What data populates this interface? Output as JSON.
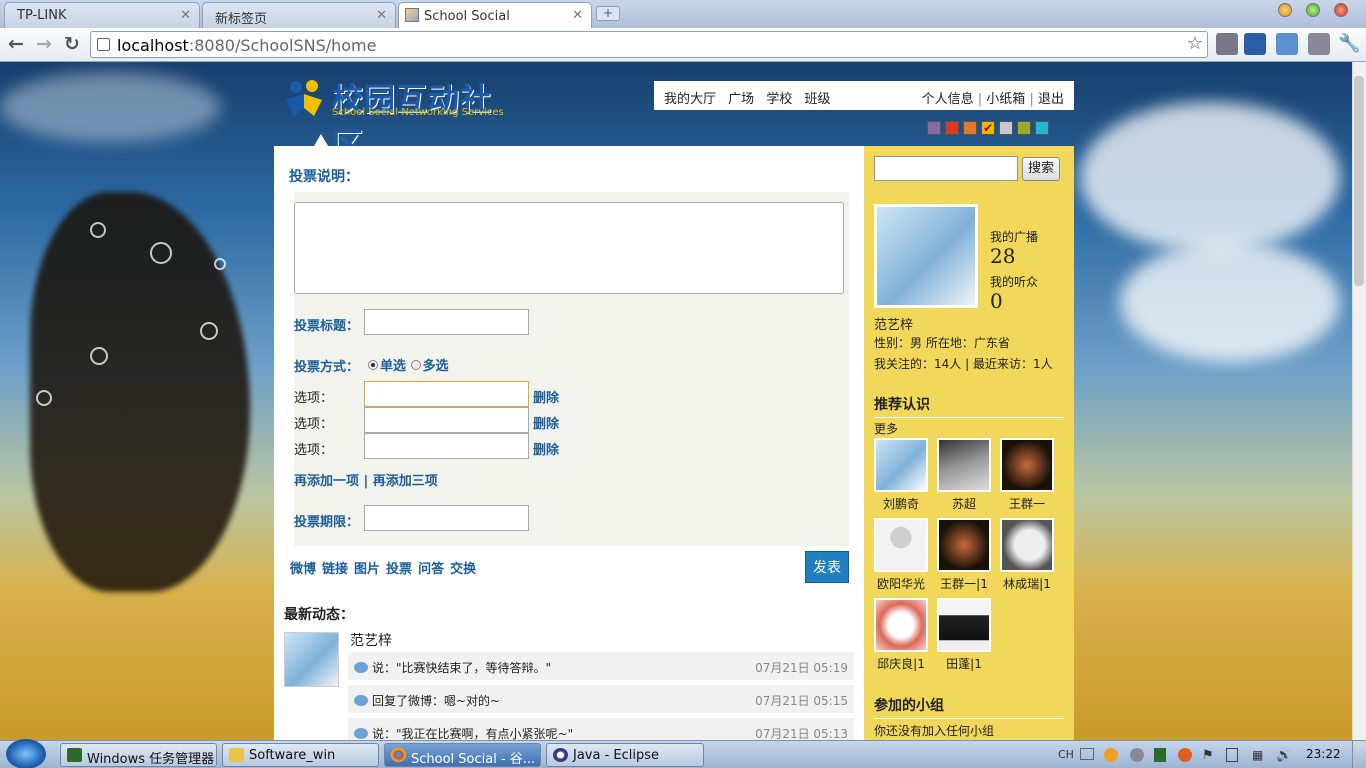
{
  "browser": {
    "tabs": [
      {
        "label": "TP-LINK"
      },
      {
        "label": "新标签页"
      },
      {
        "label": "School Social"
      }
    ],
    "url_host": "localhost",
    "url_path": ":8080/SchoolSNS/home"
  },
  "site": {
    "logo_title": "校园互动社区",
    "logo_subtitle": "School Social Networking Services",
    "nav_left": [
      "我的大厅",
      "广场",
      "学校",
      "班级"
    ],
    "nav_right": [
      "个人信息",
      "小纸箱",
      "退出"
    ],
    "swatch_colors": [
      "#8a6aa0",
      "#d93a26",
      "#e07830",
      "#e8b800",
      "#c8c8d0",
      "#9aaa2a",
      "#22b8d0"
    ]
  },
  "vote": {
    "desc_label": "投票说明：",
    "title_label": "投票标题：",
    "mode_label": "投票方式：",
    "single": "单选",
    "multi": "多选",
    "option_label": "选项：",
    "delete_label": "删除",
    "add_links": "再添加一项 | 再添加三项",
    "deadline_label": "投票期限："
  },
  "post_tools": {
    "items": [
      "微博",
      "链接",
      "图片",
      "投票",
      "问答",
      "交换"
    ],
    "send_label": "发表"
  },
  "feed": {
    "heading": "最新动态：",
    "user": "范艺梓",
    "items": [
      {
        "text": "说：\"比赛快结束了，等待答辩。\"",
        "time": "07月21日 05:19"
      },
      {
        "text": "回复了微博：嗯~对的~",
        "time": "07月21日 05:15"
      },
      {
        "text": "说：\"我正在比赛啊，有点小紧张呢~\"",
        "time": "07月21日 05:13"
      }
    ]
  },
  "sidebar": {
    "search_button": "搜索",
    "broadcast_label": "我的广播",
    "broadcast_count": "28",
    "listener_label": "我的听众",
    "listener_count": "0",
    "name": "范艺梓",
    "info": "性别：男 所在地：广东省",
    "follow": "我关注的：14人 | 最近来访：1人",
    "recommend_title": "推荐认识",
    "more": "更多",
    "people": [
      "刘鹏奇",
      "苏超",
      "王群一",
      "欧阳华光",
      "王群一|1",
      "林成瑞|1",
      "邱庆良|1",
      "田蓬|1"
    ],
    "groups_title": "参加的小组",
    "groups_empty": "你还没有加入任何小组"
  },
  "taskbar": {
    "tasks": [
      "Windows 任务管理器",
      "Software_win",
      "School Social - 谷...",
      "Java  -  Eclipse"
    ],
    "lang": "CH",
    "time": "23:22"
  }
}
